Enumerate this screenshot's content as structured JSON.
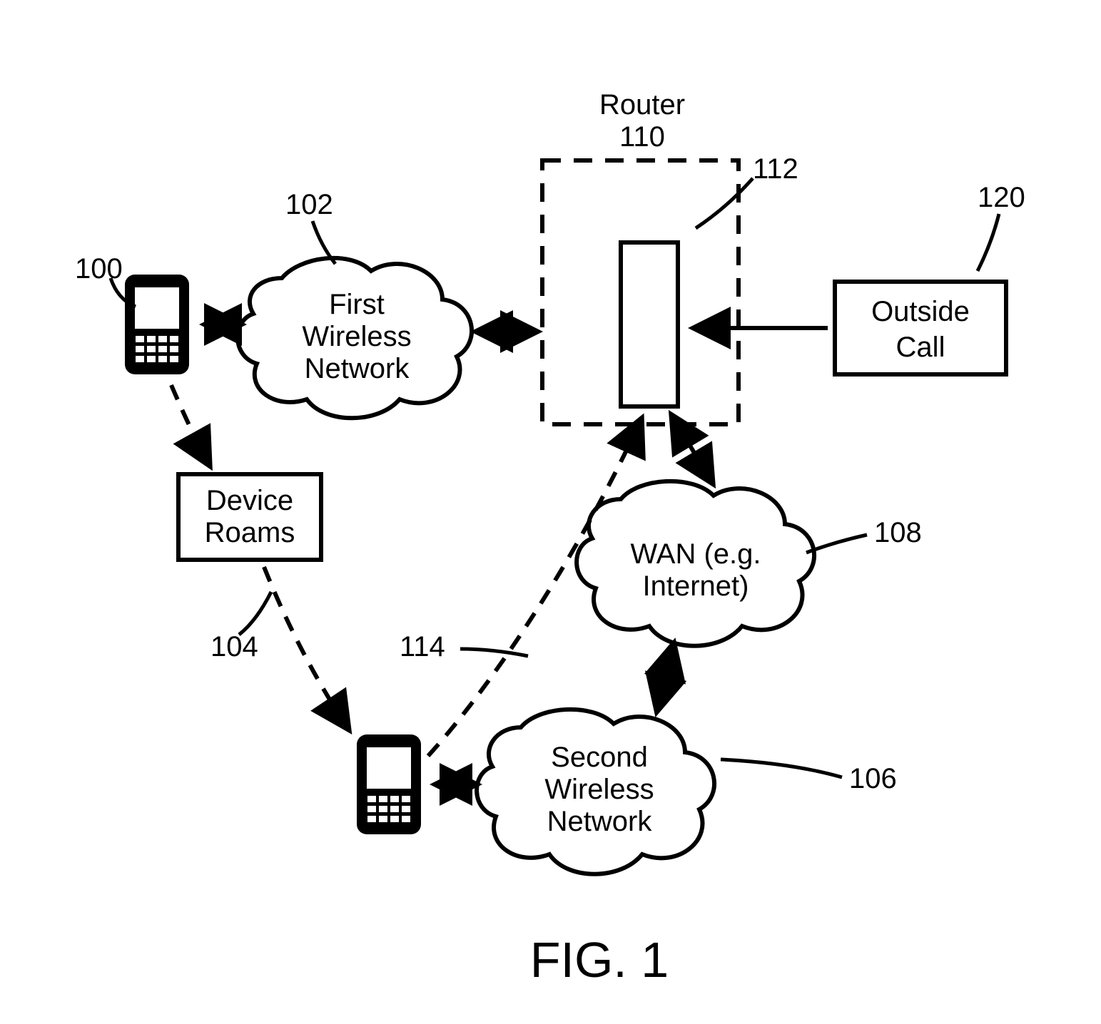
{
  "figure": {
    "caption": "FIG. 1",
    "labels": {
      "n100": "100",
      "n102": "102",
      "n104": "104",
      "n106": "106",
      "n108": "108",
      "n110": "110",
      "n112": "112",
      "n114": "114",
      "n120": "120"
    },
    "blocks": {
      "router": "Router",
      "first_net_1": "First",
      "first_net_2": "Wireless",
      "first_net_3": "Network",
      "second_net_1": "Second",
      "second_net_2": "Wireless",
      "second_net_3": "Network",
      "wan_1": "WAN (e.g.",
      "wan_2": "Internet)",
      "device_roams_1": "Device",
      "device_roams_2": "Roams",
      "outside_call_1": "Outside",
      "outside_call_2": "Call"
    }
  }
}
